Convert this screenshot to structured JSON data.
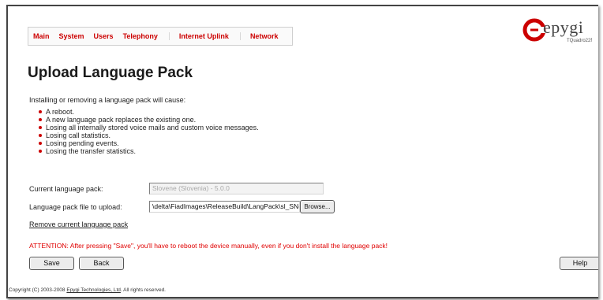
{
  "nav": {
    "items": [
      {
        "label": "Main"
      },
      {
        "label": "System"
      },
      {
        "label": "Users"
      },
      {
        "label": "Telephony"
      },
      {
        "label": "Internet Uplink"
      },
      {
        "label": "Network"
      }
    ]
  },
  "logo": {
    "text": "epygi",
    "model": "TQuadro22f"
  },
  "page": {
    "title": "Upload Language Pack",
    "intro": "Installing or removing a language pack will cause:",
    "bullets": [
      "A reboot.",
      "A new language pack replaces the existing one.",
      "Losing all internally stored voice mails and custom voice messages.",
      "Losing call statistics.",
      "Losing pending events.",
      "Losing the transfer statistics."
    ]
  },
  "form": {
    "current_label": "Current language pack:",
    "current_value": "Slovene (Slovenia) - 5.0.0",
    "upload_label": "Language pack file to upload:",
    "upload_value": "\\delta\\FiadImages\\ReleaseBuild\\LangPack\\sl_SN(",
    "browse_label": "Browse...",
    "remove_link": "Remove current language pack"
  },
  "attention": "ATTENTION: After pressing \"Save\", you'll have to reboot the device manually, even if you don't install the language pack!",
  "buttons": {
    "save": "Save",
    "back": "Back",
    "help": "Help"
  },
  "footer": {
    "prefix": "Copyright (C) 2003-2008 ",
    "company": "Epygi Technologies, Ltd",
    "suffix": ". All rights reserved."
  },
  "colors": {
    "accent": "#cc0000",
    "attention": "#e00000"
  }
}
